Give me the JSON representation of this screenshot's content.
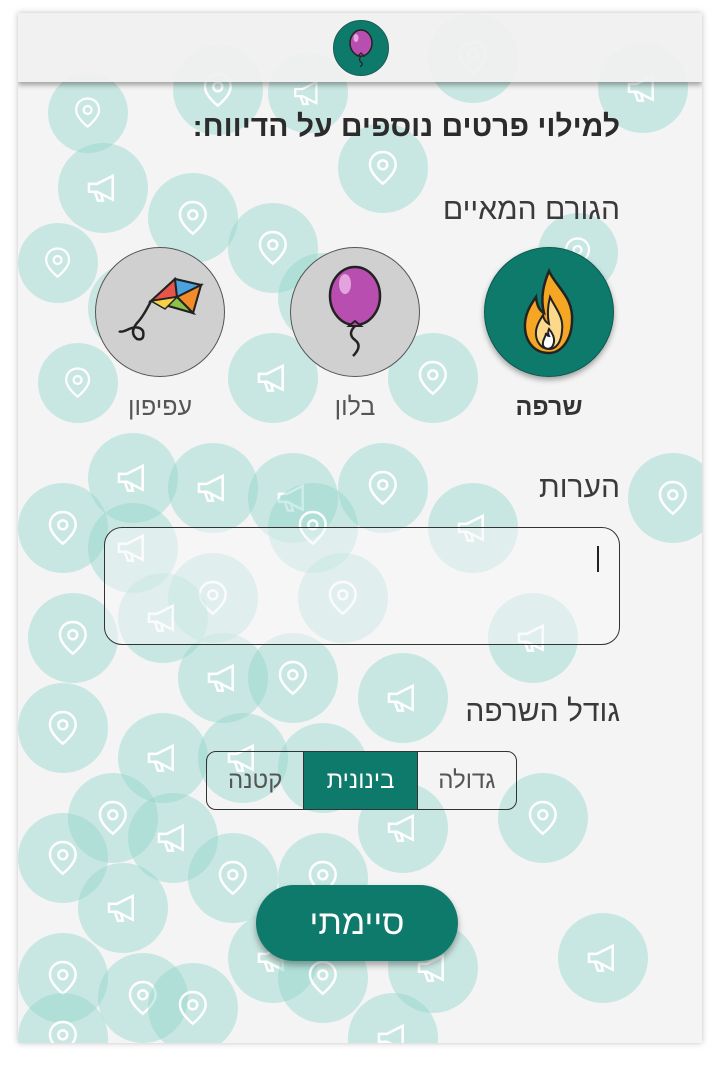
{
  "header": {
    "logo_icon": "balloon-icon"
  },
  "form": {
    "title": "למילוי פרטים נוספים על הדיווח:",
    "cause_label": "הגורם המאיים",
    "causes": [
      {
        "label": "שרפה",
        "icon": "fire-icon",
        "selected": true
      },
      {
        "label": "בלון",
        "icon": "balloon-icon",
        "selected": false
      },
      {
        "label": "עפיפון",
        "icon": "kite-icon",
        "selected": false
      }
    ],
    "notes_label": "הערות",
    "notes_value": "",
    "size_label": "גודל השרפה",
    "size_options": [
      "גדולה",
      "בינונית",
      "קטנה"
    ],
    "size_selected": "בינונית",
    "submit_label": "סיימתי"
  },
  "colors": {
    "accent": "#0e7a6b",
    "bubble": "#8cd4c8"
  }
}
